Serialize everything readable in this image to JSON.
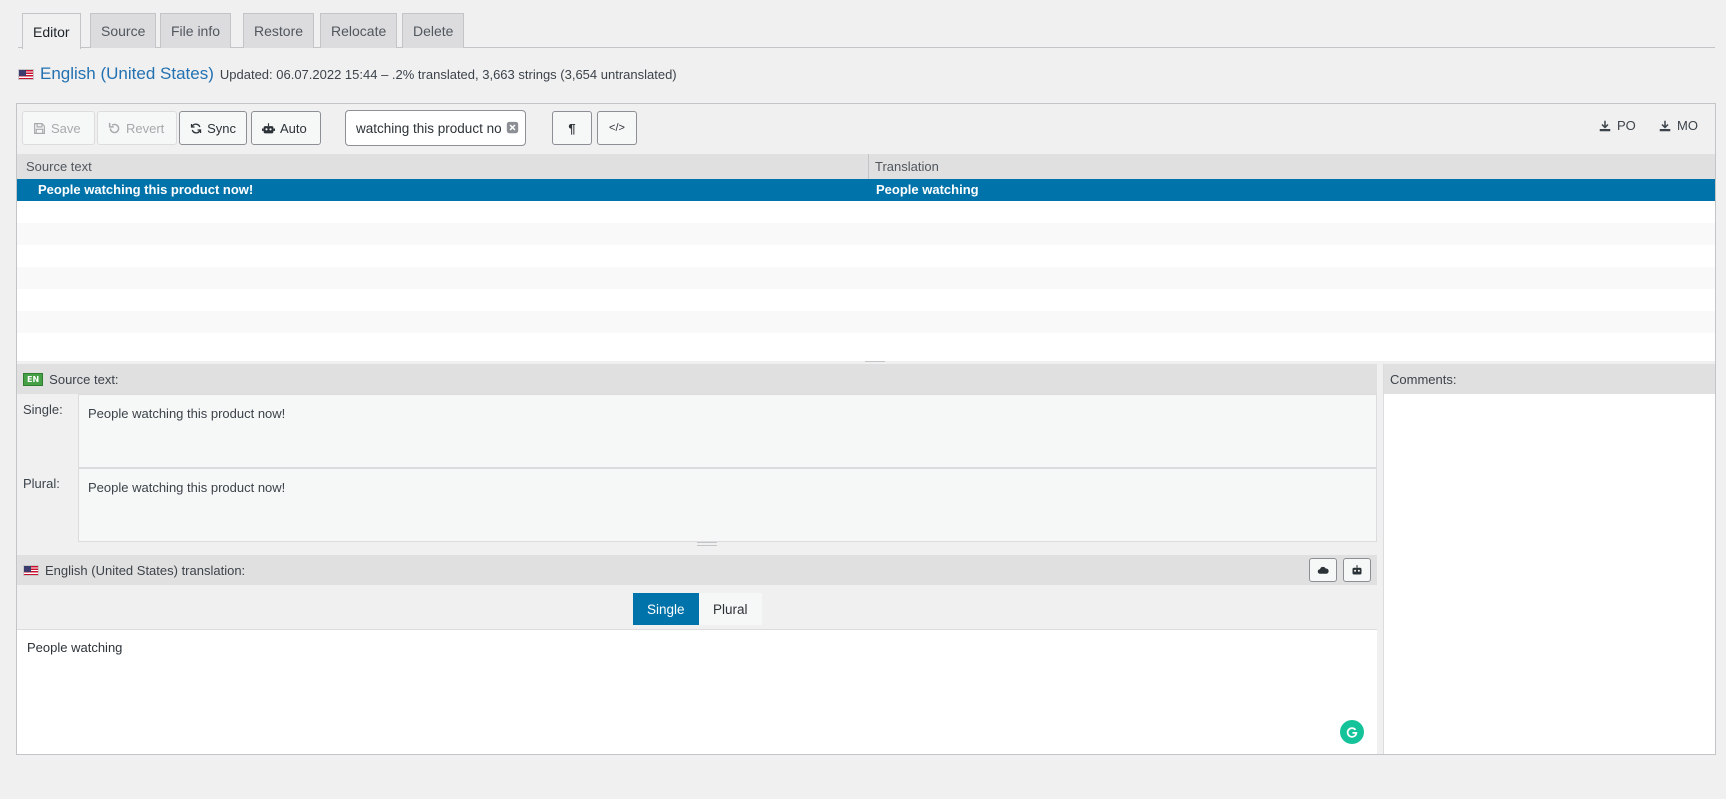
{
  "tabs": [
    {
      "label": "Editor",
      "active": true
    },
    {
      "label": "Source",
      "active": false
    },
    {
      "label": "File info",
      "active": false
    },
    {
      "label": "Restore",
      "active": false
    },
    {
      "label": "Relocate",
      "active": false
    },
    {
      "label": "Delete",
      "active": false
    }
  ],
  "header": {
    "flag_icon": "us-flag-icon",
    "language": "English (United States)",
    "meta": "Updated: 06.07.2022 15:44 – .2% translated, 3,663 strings (3,654 untranslated)"
  },
  "toolbar": {
    "save_label": "Save",
    "revert_label": "Revert",
    "sync_label": "Sync",
    "auto_label": "Auto",
    "search_value": "watching this product now",
    "pilcrow_glyph": "¶",
    "code_glyph": "</>",
    "po_label": "PO",
    "mo_label": "MO"
  },
  "list": {
    "col_source": "Source text",
    "col_translation": "Translation",
    "rows": [
      {
        "source": "People watching this product now!",
        "translation": "People watching",
        "selected": true
      }
    ]
  },
  "source_pane": {
    "badge": "EN",
    "title": "Source text:",
    "single_label": "Single:",
    "single_value": "People watching this product now!",
    "plural_label": "Plural:",
    "plural_value": "People watching this product now!"
  },
  "translation_pane": {
    "title": "English (United States) translation:",
    "tab_single": "Single",
    "tab_plural": "Plural",
    "value": "People watching"
  },
  "comments": {
    "title": "Comments:"
  },
  "colors": {
    "accent": "#0073aa",
    "link": "#2271b1",
    "grammarly": "#15c39a"
  }
}
